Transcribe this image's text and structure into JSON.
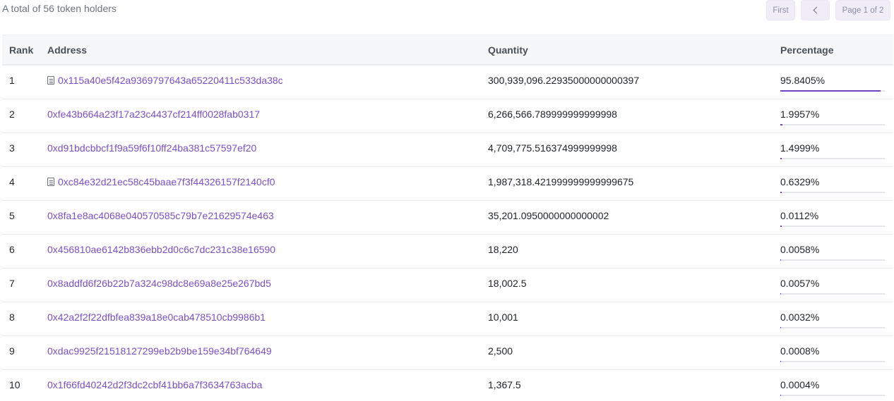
{
  "summary": "A total of 56 token holders",
  "pager": {
    "first": "First",
    "page": "Page 1 of 2"
  },
  "columns": {
    "rank": "Rank",
    "address": "Address",
    "quantity": "Quantity",
    "percentage": "Percentage"
  },
  "colors": {
    "link": "#7b4fc9",
    "bar_fill": "#6f42c1"
  },
  "holders": [
    {
      "rank": "1",
      "address": "0x115a40e5f42a9369797643a65220411c533da38c",
      "contract": true,
      "quantity": "300,939,096.22935000000000397",
      "percentage": "95.8405%",
      "share": 0.958405
    },
    {
      "rank": "2",
      "address": "0xfe43b664a23f17a23c4437cf214ff0028fab0317",
      "contract": false,
      "quantity": "6,266,566.789999999999998",
      "percentage": "1.9957%",
      "share": 0.019957
    },
    {
      "rank": "3",
      "address": "0xd91bdcbbcf1f9a59f6f10ff24ba381c57597ef20",
      "contract": false,
      "quantity": "4,709,775.516374999999998",
      "percentage": "1.4999%",
      "share": 0.014999
    },
    {
      "rank": "4",
      "address": "0xc84e32d21ec58c45baae7f3f44326157f2140cf0",
      "contract": true,
      "quantity": "1,987,318.421999999999999675",
      "percentage": "0.6329%",
      "share": 0.006329
    },
    {
      "rank": "5",
      "address": "0x8fa1e8ac4068e040570585c79b7e21629574e463",
      "contract": false,
      "quantity": "35,201.0950000000000002",
      "percentage": "0.0112%",
      "share": 0.000112
    },
    {
      "rank": "6",
      "address": "0x456810ae6142b836ebb2d0c6c7dc231c38e16590",
      "contract": false,
      "quantity": "18,220",
      "percentage": "0.0058%",
      "share": 5.8e-05
    },
    {
      "rank": "7",
      "address": "0x8addfd6f26b22b7a324c98dc8e69a8e25e267bd5",
      "contract": false,
      "quantity": "18,002.5",
      "percentage": "0.0057%",
      "share": 5.7e-05
    },
    {
      "rank": "8",
      "address": "0x42a2f2f22dfbfea839a18e0cab478510cb9986b1",
      "contract": false,
      "quantity": "10,001",
      "percentage": "0.0032%",
      "share": 3.2e-05
    },
    {
      "rank": "9",
      "address": "0xdac9925f21518127299eb2b9be159e34bf764649",
      "contract": false,
      "quantity": "2,500",
      "percentage": "0.0008%",
      "share": 8e-06
    },
    {
      "rank": "10",
      "address": "0x1f66fd40242d2f3dc2cbf41bb6a7f3634763acba",
      "contract": false,
      "quantity": "1,367.5",
      "percentage": "0.0004%",
      "share": 4e-06
    }
  ]
}
